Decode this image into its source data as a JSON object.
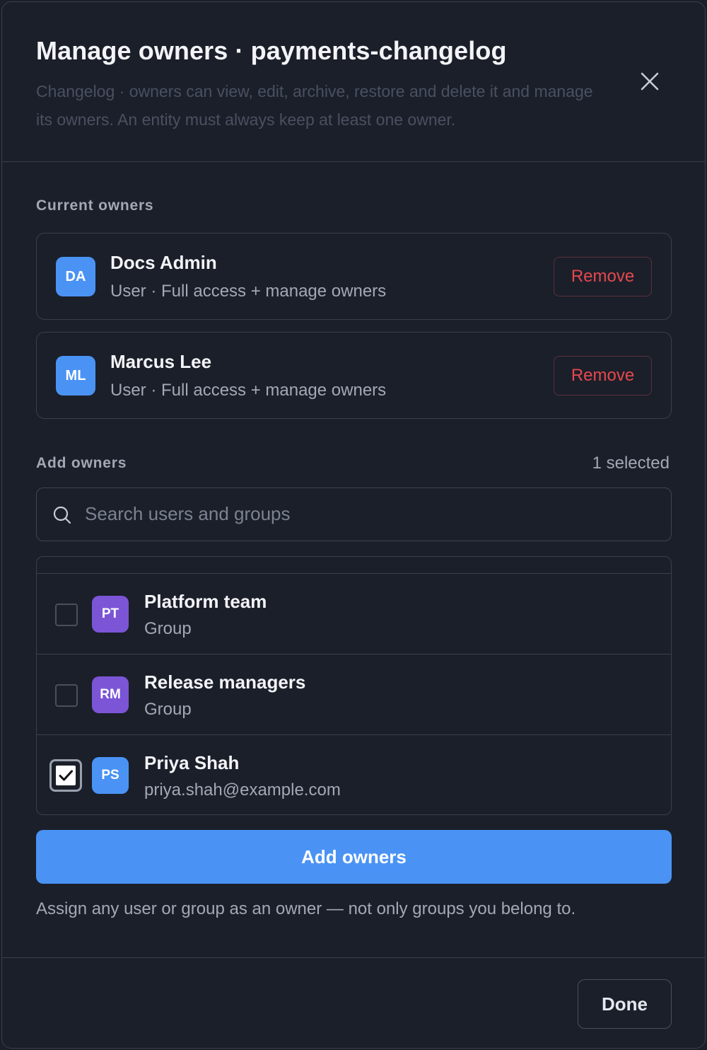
{
  "dialog": {
    "title": "Manage owners · payments-changelog",
    "subtitle": "Changelog · owners can view, edit, archive, restore and delete it and manage its owners. An entity must always keep at least one owner.",
    "close_icon": "close-icon"
  },
  "current_owners": {
    "label": "Current owners",
    "owners": [
      {
        "initials": "DA",
        "name": "Docs Admin",
        "meta": "User · Full access + manage owners",
        "remove_label": "Remove",
        "avatar_color": "#4a93f5"
      },
      {
        "initials": "ML",
        "name": "Marcus Lee",
        "meta": "User · Full access + manage owners",
        "remove_label": "Remove",
        "avatar_color": "#4a93f5"
      }
    ]
  },
  "add_owners": {
    "label": "Add owners",
    "selected_count": "1 selected",
    "search": {
      "placeholder": "Search users and groups",
      "value": ""
    },
    "candidates": [
      {
        "initials": "PT",
        "name": "Platform team",
        "meta": "Group",
        "checked": false,
        "avatar_color": "#7b55d6"
      },
      {
        "initials": "RM",
        "name": "Release managers",
        "meta": "Group",
        "checked": false,
        "avatar_color": "#7b55d6"
      },
      {
        "initials": "PS",
        "name": "Priya Shah",
        "meta": "priya.shah@example.com",
        "checked": true,
        "avatar_color": "#4a93f5"
      }
    ],
    "button_label": "Add owners",
    "hint": "Assign any user or group as an owner — not only groups you belong to."
  },
  "footer": {
    "done_label": "Done"
  },
  "colors": {
    "background": "#1b1f2a",
    "border": "#3a3f4b",
    "primary": "#4a93f5",
    "danger": "#e5484d",
    "group_avatar": "#7b55d6"
  }
}
